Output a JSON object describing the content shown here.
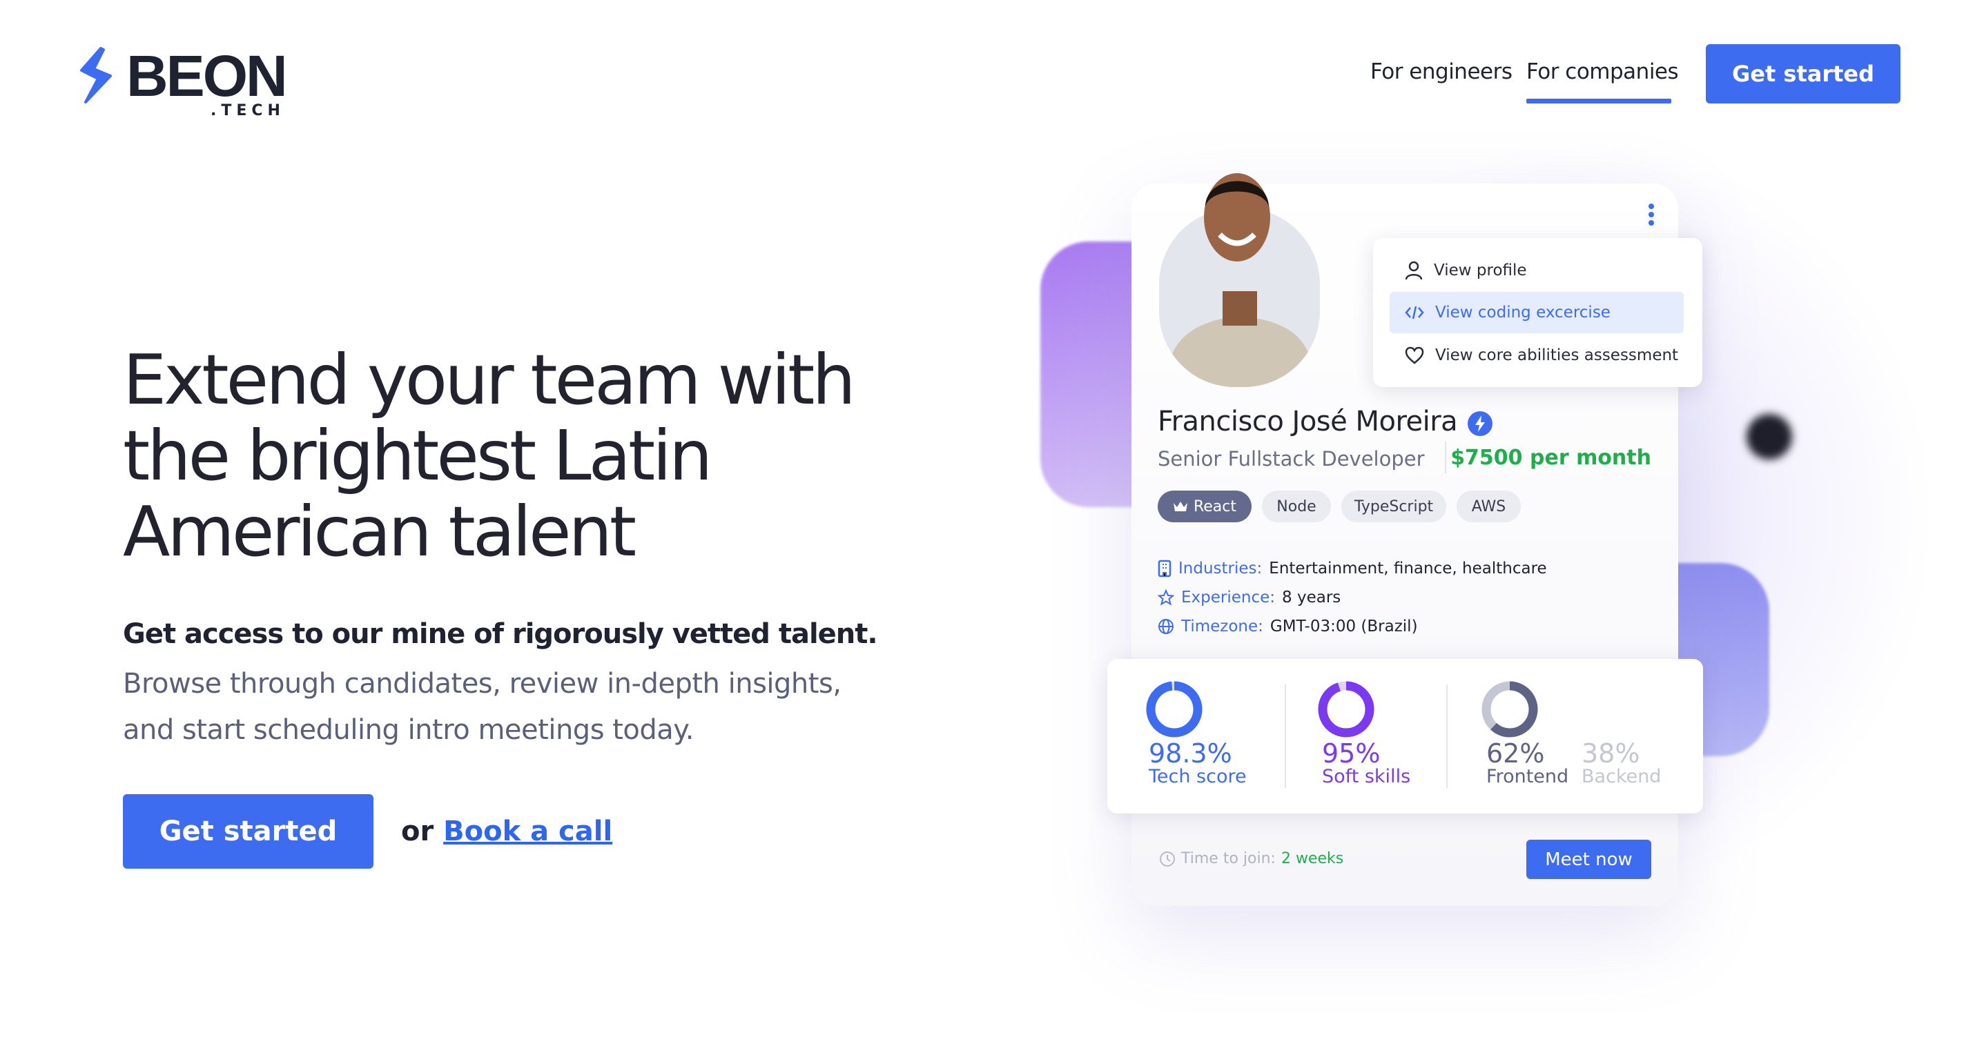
{
  "brand": {
    "name": "BEON",
    "suffix": ".TECH",
    "accent": "#3d6cf0"
  },
  "nav": {
    "items": [
      "For engineers",
      "For companies"
    ],
    "active": "For companies",
    "cta": "Get started"
  },
  "hero": {
    "headline": "Extend your team with the brightest Latin American talent",
    "subheadline": "Get access to our mine of rigorously vetted talent.",
    "body": "Browse through candidates, review in-depth insights, and start scheduling intro meetings today.",
    "cta": "Get started",
    "or": "or",
    "link": "Book a call"
  },
  "profile": {
    "name": "Francisco José Moreira",
    "role": "Senior Fullstack Developer",
    "price": "$7500 per month",
    "menu": [
      {
        "icon": "user-icon",
        "label": "View profile"
      },
      {
        "icon": "code-icon",
        "label": "View coding excercise",
        "highlighted": true
      },
      {
        "icon": "heart-icon",
        "label": "View core abilities assessment"
      }
    ],
    "tags": [
      "React",
      "Node",
      "TypeScript",
      "AWS"
    ],
    "details": [
      {
        "icon": "building-icon",
        "key": "Industries:",
        "value": "Entertainment, finance, healthcare"
      },
      {
        "icon": "star-icon",
        "key": "Experience:",
        "value": "8 years"
      },
      {
        "icon": "globe-icon",
        "key": "Timezone:",
        "value": "GMT-03:00 (Brazil)"
      }
    ],
    "stats": [
      {
        "value": "98.3%",
        "label": "Tech score",
        "percent": 98.3,
        "color": "#3d6cf0"
      },
      {
        "value": "95%",
        "label": "Soft skills",
        "percent": 95,
        "color": "#7b3af0"
      },
      {
        "value": "62%",
        "label": "Frontend",
        "percent": 62,
        "color": "#5e6385"
      },
      {
        "value": "38%",
        "label": "Backend",
        "percent": 38,
        "color": "#c4c6d4"
      }
    ],
    "time_label": "Time to join:",
    "time_value": "2 weeks",
    "meet": "Meet now"
  }
}
